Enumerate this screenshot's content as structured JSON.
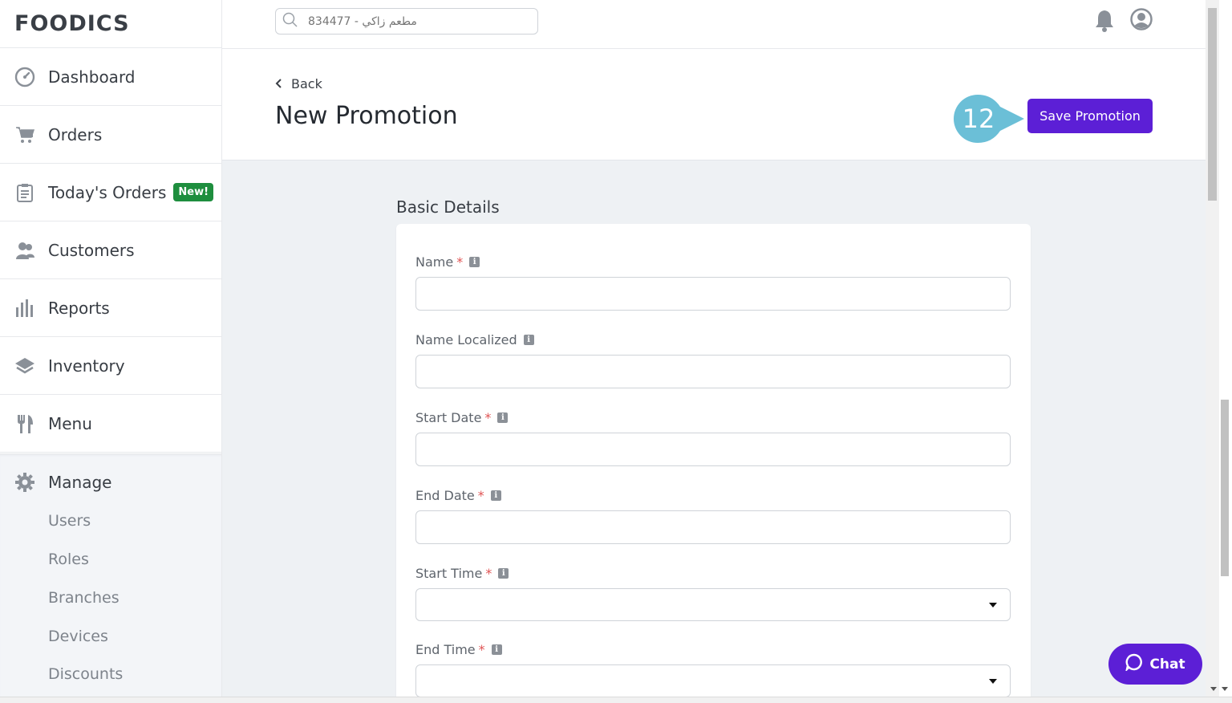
{
  "app": {
    "logo": "FOODICS"
  },
  "search": {
    "placeholder": "مطعم زاكي - 834477"
  },
  "sidebar": {
    "items": [
      {
        "label": "Dashboard",
        "icon": "dashboard-gauge-icon"
      },
      {
        "label": "Orders",
        "icon": "cart-icon"
      },
      {
        "label": "Today's Orders",
        "icon": "clipboard-icon",
        "badge": "New!"
      },
      {
        "label": "Customers",
        "icon": "customers-icon"
      },
      {
        "label": "Reports",
        "icon": "bar-chart-icon"
      },
      {
        "label": "Inventory",
        "icon": "layers-icon"
      },
      {
        "label": "Menu",
        "icon": "fork-knife-icon"
      }
    ],
    "manage": {
      "label": "Manage",
      "icon": "gear-icon",
      "subitems": [
        "Users",
        "Roles",
        "Branches",
        "Devices",
        "Discounts"
      ]
    }
  },
  "header": {
    "back_label": "Back",
    "title": "New Promotion",
    "save_label": "Save Promotion",
    "step_number": "12"
  },
  "form": {
    "section_title": "Basic Details",
    "fields": [
      {
        "label": "Name",
        "required": true,
        "type": "text",
        "value": ""
      },
      {
        "label": "Name Localized",
        "required": false,
        "type": "text",
        "value": ""
      },
      {
        "label": "Start Date",
        "required": true,
        "type": "text",
        "value": ""
      },
      {
        "label": "End Date",
        "required": true,
        "type": "text",
        "value": ""
      },
      {
        "label": "Start Time",
        "required": true,
        "type": "select",
        "value": ""
      },
      {
        "label": "End Time",
        "required": true,
        "type": "select",
        "value": ""
      }
    ],
    "required_marker": "*",
    "info_glyph": "i"
  },
  "chat": {
    "label": "Chat"
  },
  "colors": {
    "accent": "#5c1fd6",
    "badge": "#1e8e3e",
    "step": "#6bbfd7"
  }
}
